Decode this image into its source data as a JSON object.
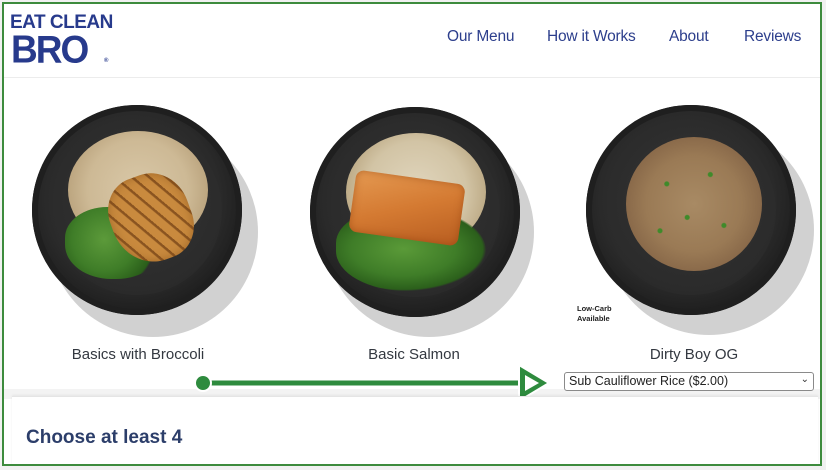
{
  "logo": {
    "line1": "EAT CLEAN",
    "line2": "BRO",
    "mark": "®"
  },
  "nav": [
    "Our Menu",
    "How it Works",
    "About",
    "Reviews"
  ],
  "products": [
    {
      "name": "Basics with Broccoli",
      "badge": ""
    },
    {
      "name": "Basic Salmon",
      "badge": ""
    },
    {
      "name": "Dirty Boy OG",
      "badge_line1": "Low-Carb",
      "badge_line2": "Available"
    }
  ],
  "select": {
    "value": "Sub Cauliflower Rice ($2.00)"
  },
  "section": {
    "title": "Choose at least 4"
  },
  "colors": {
    "brand": "#273a8c",
    "annotation": "#2e8b3e"
  }
}
